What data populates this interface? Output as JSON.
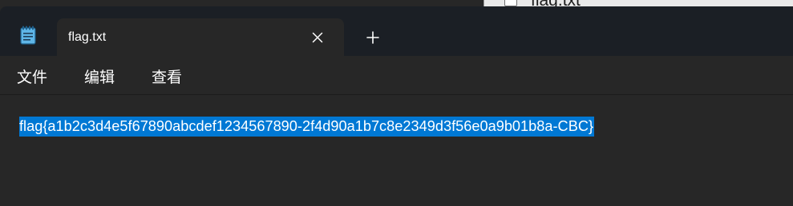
{
  "background_window": {
    "title": "flag.txt"
  },
  "tab": {
    "title": "flag.txt",
    "close_icon": "close-icon",
    "new_tab_icon": "plus-icon"
  },
  "app": {
    "icon": "notepad-icon"
  },
  "menu": {
    "items": [
      {
        "label": "文件"
      },
      {
        "label": "编辑"
      },
      {
        "label": "查看"
      }
    ]
  },
  "editor": {
    "text": "flag{a1b2c3d4e5f67890abcdef1234567890-2f4d90a1b7c8e2349d3f56e0a9b01b8a-CBC}",
    "selected": true
  },
  "colors": {
    "titlebar": "#1b1f25",
    "tab_active": "#272727",
    "editor_bg": "#272727",
    "selection": "#0078d4",
    "text": "#ffffff"
  }
}
